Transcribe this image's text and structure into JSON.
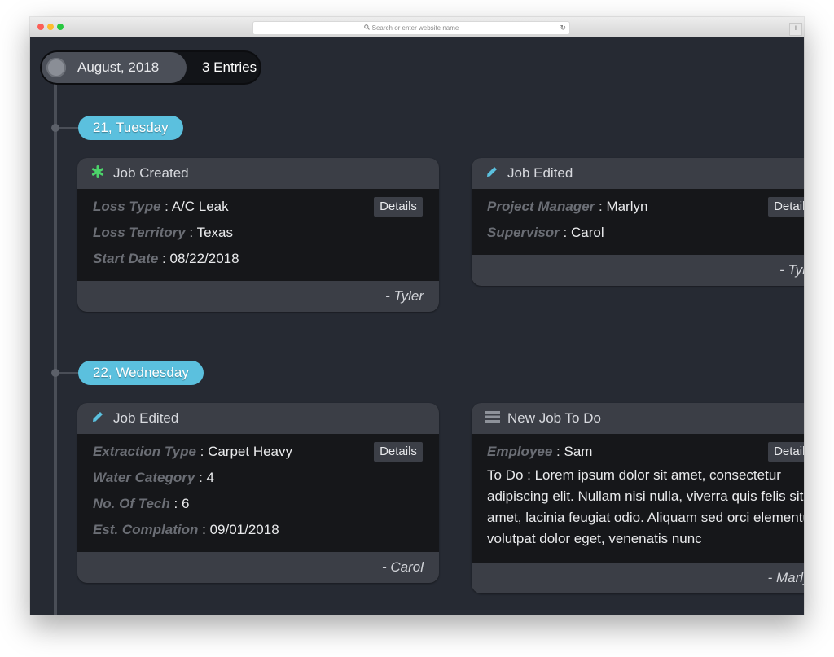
{
  "browser": {
    "url_placeholder": "Search or enter website name",
    "new_tab_label": "+"
  },
  "timeline": {
    "month": "August, 2018",
    "entries": "3 Entries",
    "days": [
      {
        "label": "21, Tuesday",
        "cards": [
          {
            "title": "Job Created",
            "icon": "asterisk-icon",
            "fields": [
              {
                "label": "Loss Type",
                "value": "A/C Leak"
              },
              {
                "label": "Loss Territory",
                "value": "Texas"
              },
              {
                "label": "Start Date",
                "value": "08/22/2018"
              }
            ],
            "details": "Details",
            "author": "- Tyler"
          },
          {
            "title": "Job Edited",
            "icon": "pencil-icon",
            "fields": [
              {
                "label": "Project Manager",
                "value": "Marlyn"
              },
              {
                "label": "Supervisor",
                "value": "Carol"
              }
            ],
            "details": "Details",
            "author": "- Tyler"
          }
        ]
      },
      {
        "label": "22, Wednesday",
        "cards": [
          {
            "title": "Job Edited",
            "icon": "pencil-icon",
            "fields": [
              {
                "label": "Extraction Type",
                "value": "Carpet Heavy"
              },
              {
                "label": "Water Category",
                "value": "4"
              },
              {
                "label": "No. Of Tech",
                "value": "6"
              },
              {
                "label": "Est. Complation",
                "value": "09/01/2018"
              }
            ],
            "details": "Details",
            "author": "- Carol"
          },
          {
            "title": "New Job To Do",
            "icon": "list-icon",
            "fields": [
              {
                "label": "Employee",
                "value": "Sam"
              },
              {
                "label": "To Do",
                "value": "Lorem ipsum dolor sit amet, consectetur adipiscing elit. Nullam nisi nulla, viverra quis felis sit amet, lacinia feugiat odio. Aliquam sed orci elementum, volutpat dolor eget, venenatis nunc"
              }
            ],
            "details": "Details",
            "author": "- Marlyn"
          }
        ]
      }
    ]
  },
  "colors": {
    "page_bg": "#262a33",
    "card_header": "#3b3e46",
    "card_body": "#16171a",
    "day_pill": "#5bc0de",
    "created_icon": "#4cd46a",
    "edit_icon": "#5bc0de"
  }
}
